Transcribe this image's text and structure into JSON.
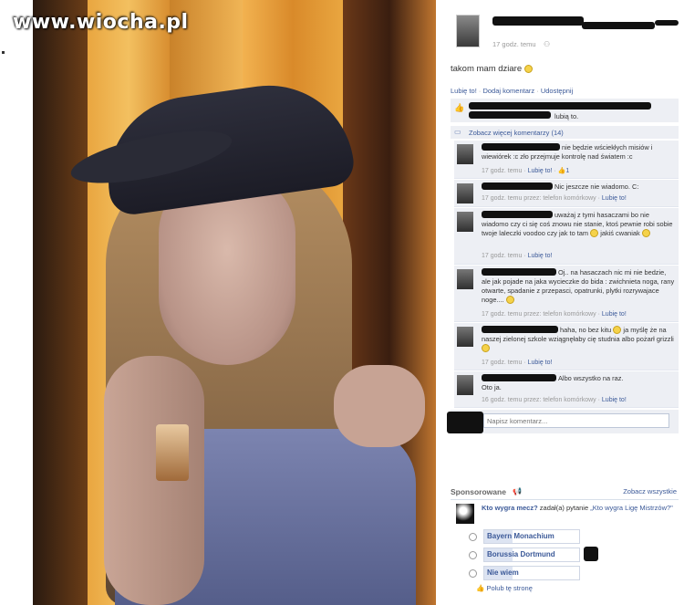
{
  "watermark": "www.wiocha.pl",
  "post": {
    "time": "17 godz. temu",
    "text": "takom mam dziare",
    "actions": {
      "like": "Lubię to!",
      "comment": "Dodaj komentarz",
      "share": "Udostępnij"
    },
    "likes_suffix": "lubią to.",
    "more_comments": "Zobacz więcej komentarzy (14)"
  },
  "comments": [
    {
      "text": "nie będzie wściekłych misiów i wiewiórek :c zło przejmuje kontrolę nad światem :c",
      "meta": "17 godz. temu · ",
      "like": "Lubię to!",
      "count": "1"
    },
    {
      "text": "Nic jeszcze nie wiadomo. C:",
      "meta": "17 godz. temu przez: telefon komórkowy · ",
      "like": "Lubię to!"
    },
    {
      "text": "uważaj z tymi hasaczami bo nie wiadomo czy ci się coś znowu nie stanie, ktoś pewnie robi sobie twoje laleczki voodoo czy jak to tam",
      "extra": "jakiś cwaniak",
      "meta": "17 godz. temu · ",
      "like": "Lubię to!"
    },
    {
      "text": "Oj.. na hasaczach nic mi nie bedzie, ale jak pojade na jaka wycieczke do bida : zwichnieta noga, rany otwarte, spadanie z przepasci, opatrunki, plytki rozrywajace noge....",
      "meta": "17 godz. temu przez: telefon komórkowy · ",
      "like": "Lubię to!"
    },
    {
      "text": "haha, no bez kitu",
      "text2": "ja myślę że na naszej zielonej szkole wziągnęłaby cię studnia albo pożarł grizzli",
      "meta": "17 godz. temu · ",
      "like": "Lubię to!"
    },
    {
      "text": "Albo wszystko na raz.",
      "text2": "Oto ja.",
      "meta": "16 godz. temu przez: telefon komórkowy · ",
      "like": "Lubię to!"
    }
  ],
  "comment_input": {
    "placeholder": "Napisz komentarz..."
  },
  "sponsored": {
    "title": "Sponsorowane",
    "see_all": "Zobacz wszystkie",
    "question_title": "Kto wygra mecz?",
    "question_mid": " zadał(a) pytanie ",
    "question_link": "„Kto wygra Ligę Mistrzów?\"",
    "options": [
      "Bayern Monachium",
      "Borussia Dortmund",
      "Nie wiem"
    ],
    "like_page": "Polub tę stronę"
  },
  "colors": {
    "link": "#3b5998",
    "comment_bg": "#edeff4"
  }
}
